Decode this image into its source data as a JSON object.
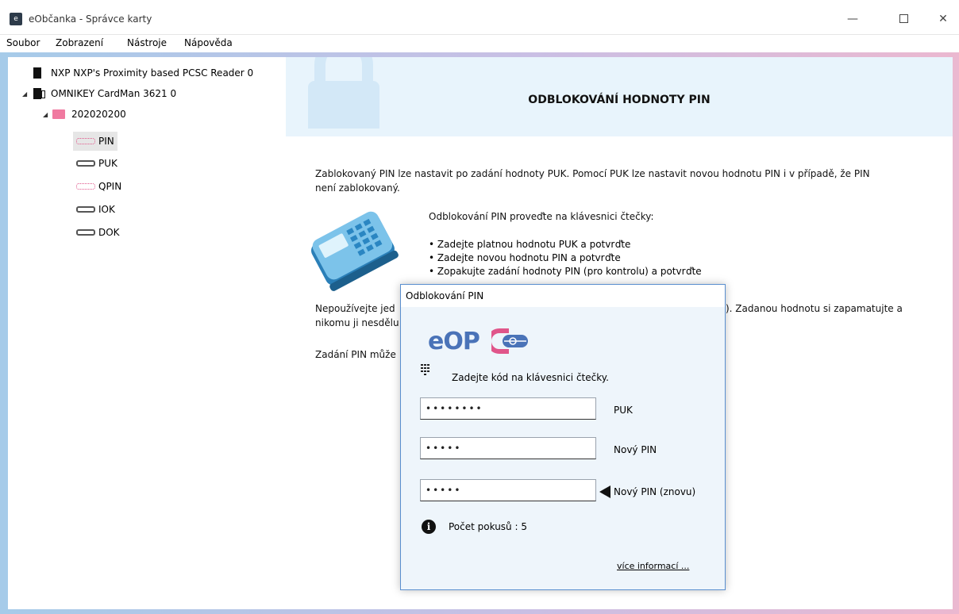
{
  "window": {
    "title": "eObčanka - Správce karty",
    "app_icon": "eo-app-icon",
    "controls": {
      "minimize": "—",
      "maximize": "",
      "close": "✕"
    }
  },
  "menu": [
    "Soubor",
    "Zobrazení",
    "Nástroje",
    "Nápověda"
  ],
  "tree": {
    "reader1": "NXP NXP's Proximity based PCSC Reader 0",
    "reader2": "OMNIKEY CardMan 3621 0",
    "card": "202020200",
    "items": [
      "PIN",
      "PUK",
      "QPIN",
      "IOK",
      "DOK"
    ],
    "selected": "PIN"
  },
  "content": {
    "title": "ODBLOKOVÁNÍ HODNOTY PIN",
    "intro": "Zablokovaný PIN lze nastavit po zadání hodnoty PUK. Pomocí PUK lze nastavit novou hodnotu PIN i v případě, že PIN",
    "intro2": "není zablokovaný.",
    "instruction": "Odblokování PIN proveďte na klávesnici čtečky:",
    "bullets": [
      "• Zadejte platnou hodnotu PUK a potvrďte",
      "• Zadejte novou hodnotu PIN a potvrďte",
      "• Zopakujte zadání hodnoty PIN (pro kontrolu) a potvrďte"
    ],
    "warn_start": "Nepoužívejte jed",
    "warn_end": "). Zadanou hodnotu si zapamatujte a",
    "warn_line2": "nikomu ji nesdělu",
    "note_start": "Zadání PIN může"
  },
  "dialog": {
    "title": "Odblokování PIN",
    "logo_text": "eOP",
    "keypad_text": "Zadejte kód na klávesnici čtečky.",
    "fields": [
      {
        "value": "••••••••",
        "label": "PUK"
      },
      {
        "value": "•••••",
        "label": "Nový PIN"
      },
      {
        "value": "•••••",
        "label": "Nový PIN (znovu)"
      }
    ],
    "attempts": "Počet pokusů : 5",
    "more_info": "více informací ..."
  },
  "colors": {
    "accent_blue": "#4a73b8",
    "accent_pink": "#e0558a",
    "header_bg": "#e8f4fc"
  }
}
